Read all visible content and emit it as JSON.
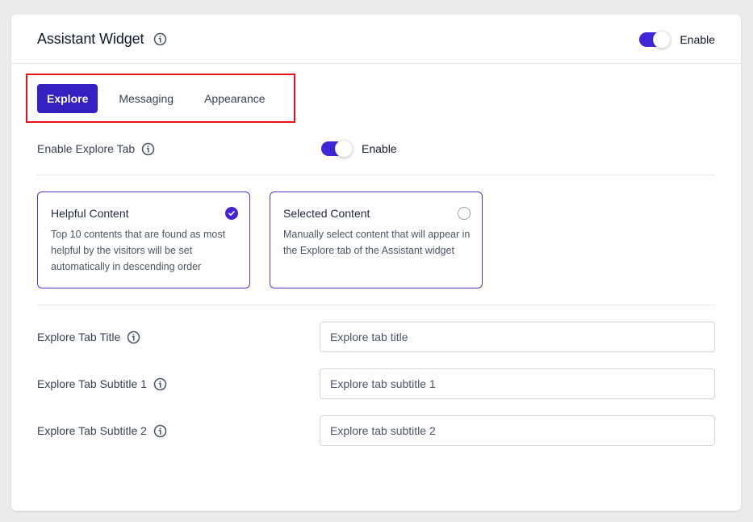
{
  "header": {
    "title": "Assistant Widget",
    "info_icon": "info-circle-icon",
    "toggle": {
      "on": true,
      "label": "Enable"
    }
  },
  "tabs": [
    {
      "label": "Explore",
      "active": true
    },
    {
      "label": "Messaging",
      "active": false
    },
    {
      "label": "Appearance",
      "active": false
    }
  ],
  "explore": {
    "enable_tab": {
      "label": "Enable Explore Tab",
      "toggle": {
        "on": true,
        "label": "Enable"
      }
    },
    "content_options": [
      {
        "title": "Helpful Content",
        "description": "Top 10 contents that are found as most helpful by the visitors will be set automatically in descending order",
        "selected": true
      },
      {
        "title": "Selected Content",
        "description": "Manually select content that will appear in the Explore tab of the Assistant widget",
        "selected": false
      }
    ],
    "fields": [
      {
        "label": "Explore Tab Title",
        "value": "",
        "placeholder": "Explore tab title"
      },
      {
        "label": "Explore Tab Subtitle 1",
        "value": "",
        "placeholder": "Explore tab subtitle 1"
      },
      {
        "label": "Explore Tab Subtitle 2",
        "value": "",
        "placeholder": "Explore tab subtitle 2"
      }
    ]
  },
  "colors": {
    "accent": "#3f26d9",
    "active_tab": "#3420c1",
    "highlight_box": "#e8101a"
  }
}
